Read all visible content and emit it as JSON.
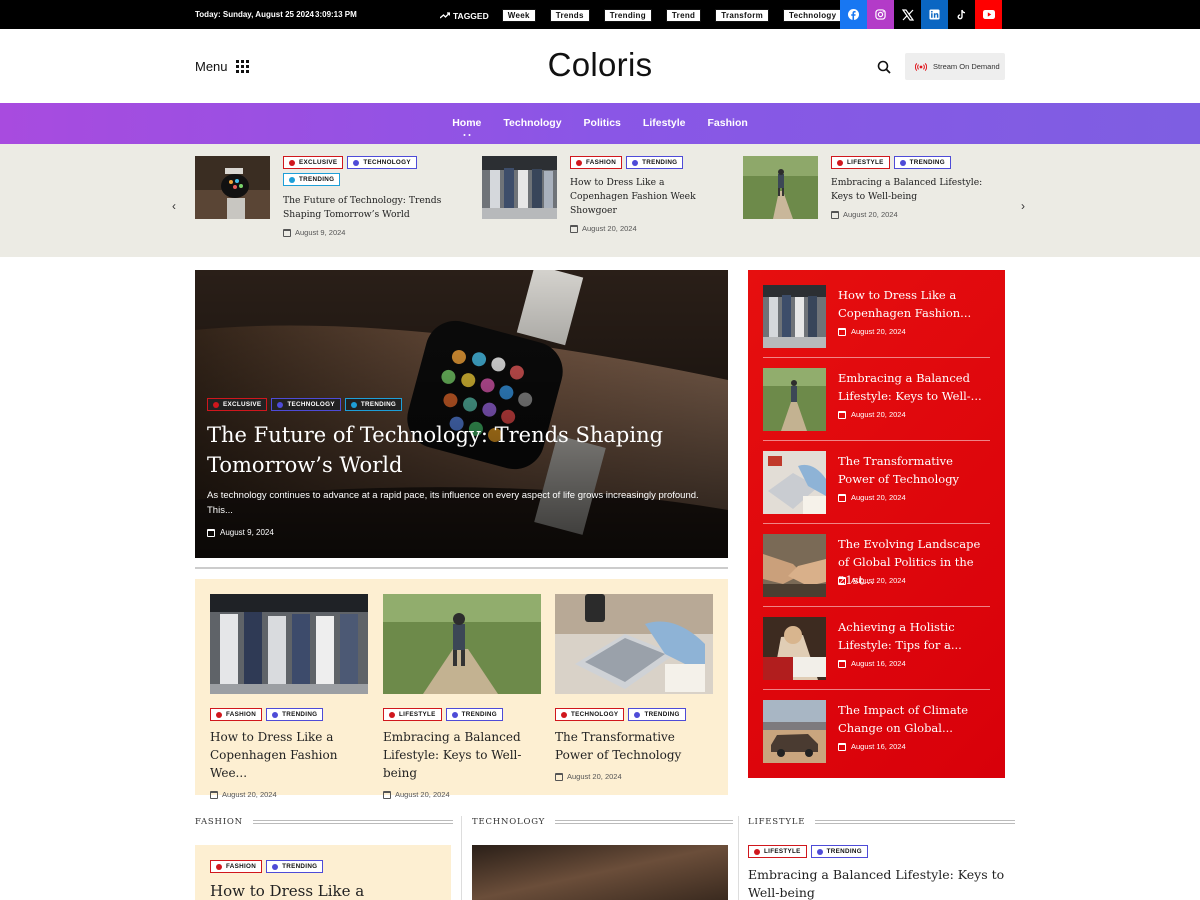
{
  "topbar": {
    "date": "Today: Sunday, August 25 2024",
    "time": "3:09:13 PM",
    "tagged_label": "TAGGED",
    "tags": [
      "Week",
      "Trends",
      "Trending",
      "Trend",
      "Transform",
      "Technology"
    ],
    "socials": [
      {
        "name": "facebook-icon",
        "glyph": "f",
        "color": "#1877f2"
      },
      {
        "name": "instagram-icon",
        "glyph": "◎",
        "color": "#b33bc8"
      },
      {
        "name": "x-icon",
        "glyph": "𝕏",
        "color": "#000000"
      },
      {
        "name": "linkedin-icon",
        "glyph": "in",
        "color": "#0a66c2"
      },
      {
        "name": "tiktok-icon",
        "glyph": "♪",
        "color": "#000000"
      },
      {
        "name": "youtube-icon",
        "glyph": "▶",
        "color": "#ff0000"
      }
    ]
  },
  "header": {
    "menu_label": "Menu",
    "logo": "Coloris",
    "stream_label": "Stream On Demand"
  },
  "nav": {
    "items": [
      "Home",
      "Technology",
      "Politics",
      "Lifestyle",
      "Fashion"
    ]
  },
  "carousel": {
    "items": [
      {
        "title": "The Future of Technology: Trends Shaping Tomorrow’s World",
        "date": "August 9, 2024",
        "tags": [
          "EXCLUSIVE",
          "TECHNOLOGY",
          "TRENDING"
        ]
      },
      {
        "title": "How to Dress Like a Copenhagen Fashion Week Showgoer",
        "date": "August 20, 2024",
        "tags": [
          "FASHION",
          "TRENDING"
        ]
      },
      {
        "title": "Embracing a Balanced Lifestyle: Keys to Well-being",
        "date": "August 20, 2024",
        "tags": [
          "LIFESTYLE",
          "TRENDING"
        ]
      }
    ]
  },
  "hero": {
    "tags": [
      "EXCLUSIVE",
      "TECHNOLOGY",
      "TRENDING"
    ],
    "title": "The Future of Technology: Trends Shaping Tomorrow’s World",
    "excerpt": "As technology continues to advance at a rapid pace, its influence on every aspect of life grows increasingly profound. This...",
    "date": "August 9, 2024"
  },
  "grid": {
    "items": [
      {
        "tags": [
          "FASHION",
          "TRENDING"
        ],
        "title": "How to Dress Like a Copenhagen Fashion Wee...",
        "date": "August 20, 2024"
      },
      {
        "tags": [
          "LIFESTYLE",
          "TRENDING"
        ],
        "title": "Embracing a Balanced Lifestyle: Keys to Well-being",
        "date": "August 20, 2024"
      },
      {
        "tags": [
          "TECHNOLOGY",
          "TRENDING"
        ],
        "title": "The Transformative Power of Technology",
        "date": "August 20, 2024"
      }
    ]
  },
  "sidebar": {
    "items": [
      {
        "title": "How to Dress Like a Copenhagen Fashion...",
        "date": "August 20, 2024"
      },
      {
        "title": "Embracing a Balanced Lifestyle: Keys to Well-...",
        "date": "August 20, 2024"
      },
      {
        "title": "The Transformative Power of Technology",
        "date": "August 20, 2024"
      },
      {
        "title": "The Evolving Landscape of Global Politics in the 21st...",
        "date": "August 20, 2024"
      },
      {
        "title": "Achieving a Holistic Lifestyle: Tips for a...",
        "date": "August 16, 2024"
      },
      {
        "title": "The Impact of Climate Change on Global...",
        "date": "August 16, 2024"
      }
    ]
  },
  "sections": {
    "fashion": {
      "label": "FASHION",
      "tags": [
        "FASHION",
        "TRENDING"
      ],
      "title": "How to Dress Like a"
    },
    "technology": {
      "label": "TECHNOLOGY"
    },
    "lifestyle": {
      "label": "LIFESTYLE",
      "tags": [
        "LIFESTYLE",
        "TRENDING"
      ],
      "title": "Embracing a Balanced Lifestyle: Keys to Well-being"
    }
  },
  "colors": {
    "nav_gradient_start": "#a84bdf",
    "nav_gradient_end": "#7e5ee2",
    "sidebar_red": "#e60f0f",
    "cream": "#fdefd2",
    "carousel_bg": "#ecebe4",
    "tag_red": "#d0171d",
    "tag_blue": "#4e4bd7",
    "tag_cyan": "#1e9fd8"
  }
}
